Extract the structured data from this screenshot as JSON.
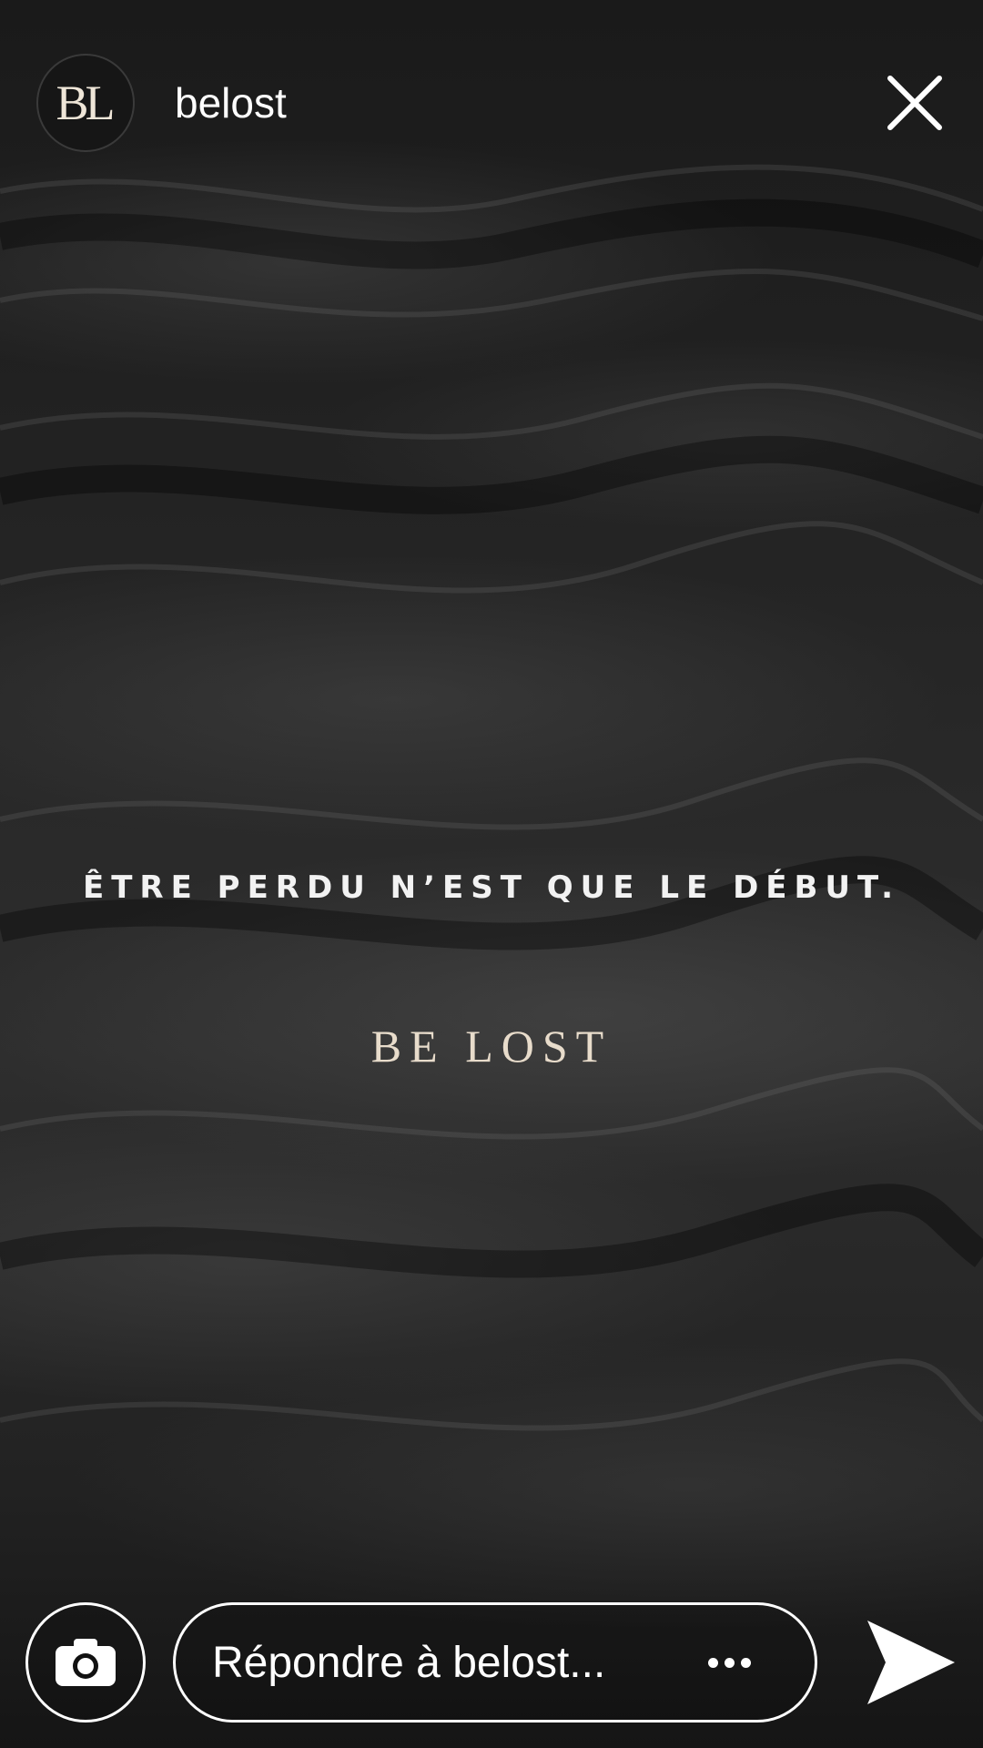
{
  "story": {
    "account": {
      "avatar_monogram": "BL",
      "username": "belost"
    },
    "quote_text": "ÊTRE PERDU N’EST QUE LE DÉBUT.",
    "brand_text": "BE LOST"
  },
  "footer": {
    "reply_placeholder": "Répondre à belost..."
  },
  "icons": {
    "close": "close-icon",
    "camera": "camera-icon",
    "more": "more-horizontal-icon",
    "send": "send-icon"
  },
  "colors": {
    "background": "#1e1e1e",
    "text_primary": "#ffffff",
    "brand_cream": "#e8dccb"
  }
}
